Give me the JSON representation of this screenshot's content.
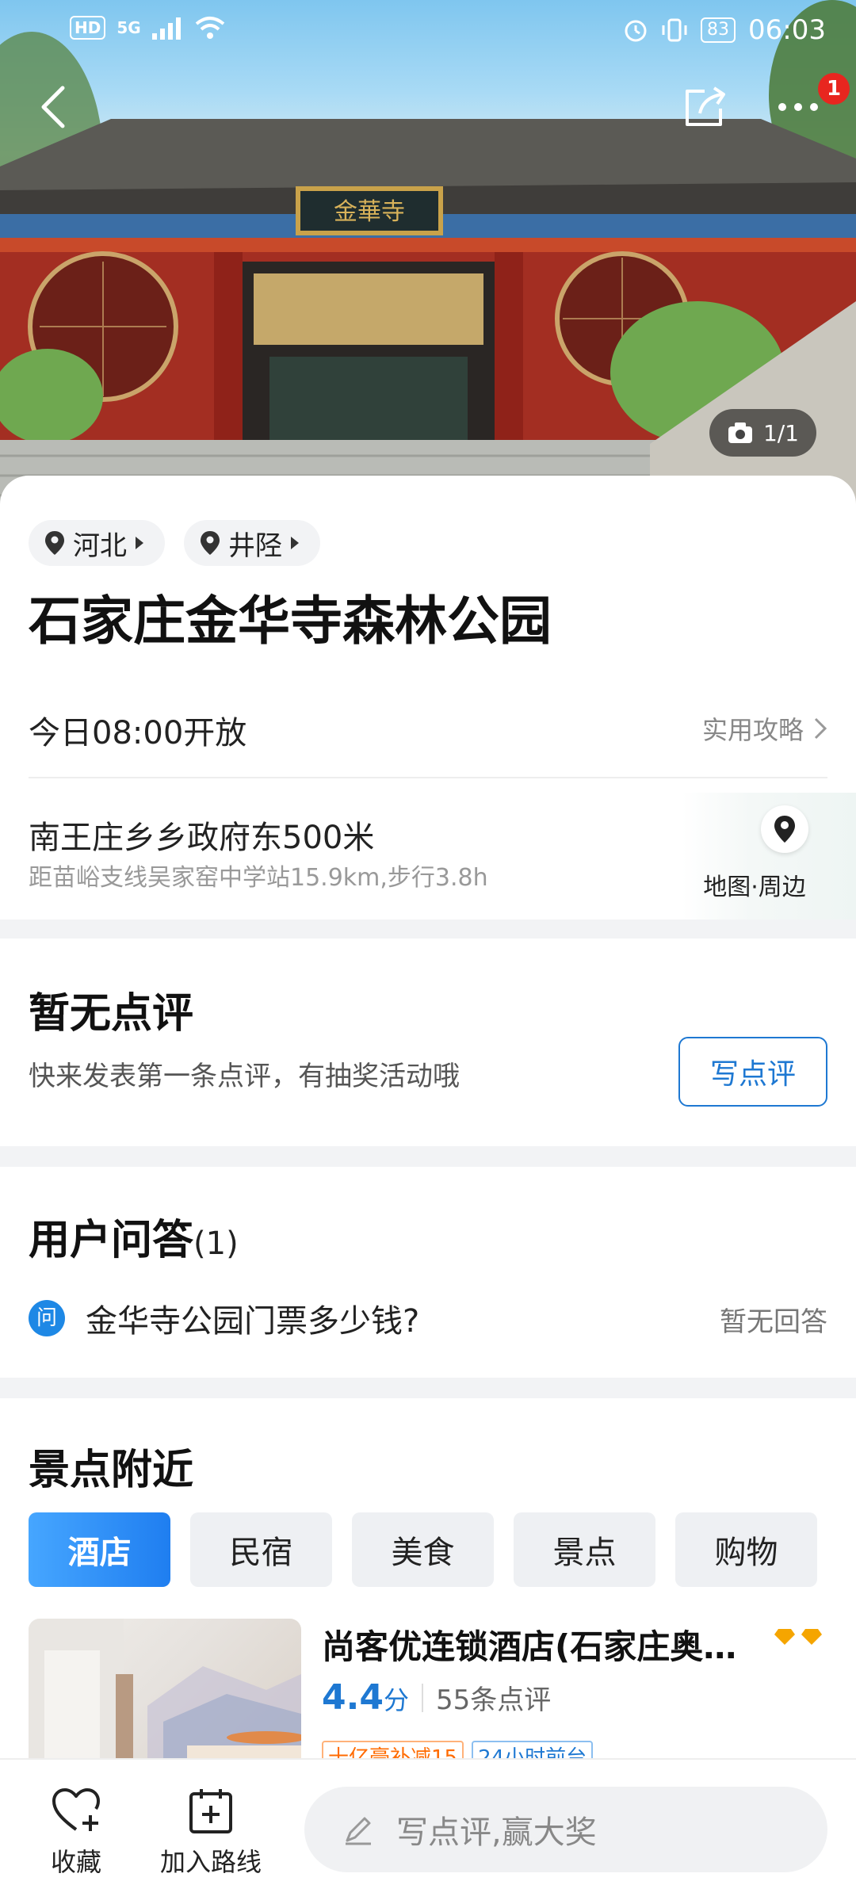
{
  "status_bar": {
    "hd": "HD",
    "network": "5G",
    "battery": "83",
    "time": "06:03"
  },
  "header": {
    "notification_count": "1",
    "photo_counter": "1/1"
  },
  "location_chips": [
    "河北",
    "井陉"
  ],
  "place": {
    "title": "石家庄金华寺森林公园",
    "open_hours": "今日08:00开放",
    "guide_link": "实用攻略",
    "address": "南王庄乡乡政府东500米",
    "distance_info": "距苗峪支线吴家窑中学站15.9km,步行3.8h",
    "map_label": "地图·周边"
  },
  "reviews": {
    "title": "暂无点评",
    "subtitle": "快来发表第一条点评，有抽奖活动哦",
    "write_button": "写点评"
  },
  "qa": {
    "title": "用户问答",
    "count": "(1)",
    "icon_label": "问",
    "question": "金华寺公园门票多少钱?",
    "status": "暂无回答"
  },
  "nearby": {
    "title": "景点附近",
    "tabs": [
      "酒店",
      "民宿",
      "美食",
      "景点",
      "购物"
    ],
    "active_tab": "酒店",
    "hotel": {
      "name": "尚客优连锁酒店(石家庄奥…",
      "score": "4.4",
      "score_unit": "分",
      "review_count": "55条点评",
      "tags": [
        "十亿豪补减15",
        "24小时前台"
      ]
    }
  },
  "bottom_bar": {
    "favorite_label": "收藏",
    "add_route_label": "加入路线",
    "comment_placeholder": "写点评,赢大奖"
  },
  "colors": {
    "accent": "#1e78d2",
    "badge_red": "#e8261f",
    "tag_orange": "#ff6b00",
    "diamond": "#f5a500"
  }
}
